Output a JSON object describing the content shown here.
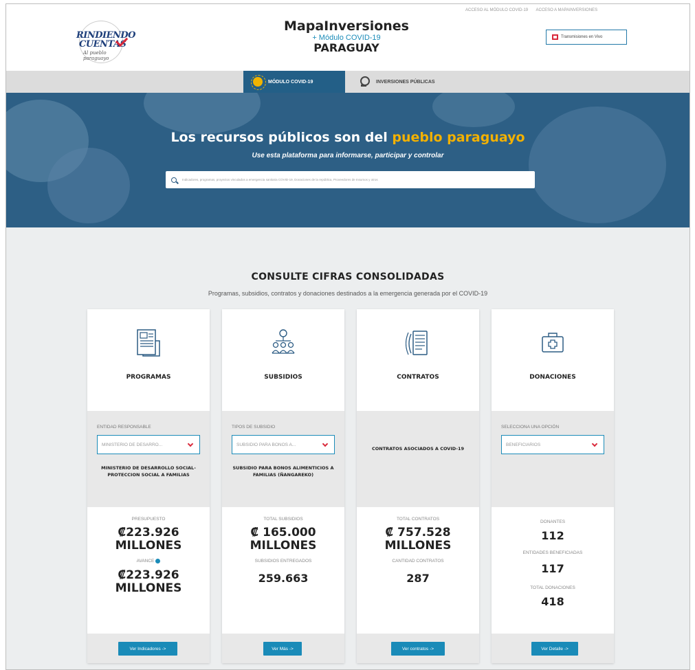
{
  "header": {
    "logo": {
      "line1": "RINDIENDO",
      "line2": "CUENTAS",
      "tagline": "Al pueblo paraguayo"
    },
    "brand": {
      "title": "MapaInversiones",
      "subtitle": "+ Módulo COVID-19",
      "country": "PARAGUAY"
    },
    "top_links": [
      "ACCESO AL MÓDULO COVID-19",
      "ACCESO A MAPAINVERSIONES"
    ],
    "live_button": "Transmisiones en Vivo"
  },
  "nav": {
    "tabs": [
      {
        "label": "MÓDULO COVID-19",
        "active": true,
        "icon": "virus-icon"
      },
      {
        "label": "INVERSIONES PÚBLICAS",
        "active": false,
        "icon": "coin-icon"
      }
    ]
  },
  "hero": {
    "title_part1": "Los recursos públicos son del",
    "title_highlight": "pueblo paraguayo",
    "subtitle": "Use esta plataforma para informarse, participar y controlar",
    "search_placeholder": "Indicadores, programas, proyectos vinculados a emergencia sanitaria COVID-19, Donaciones de la república, Proveedores de Insumos y otros"
  },
  "section": {
    "title": "CONSULTE CIFRAS CONSOLIDADAS",
    "subtitle": "Programas, subsidios, contratos y donaciones destinados a la emergencia generada por el COVID-19"
  },
  "cards": {
    "programas": {
      "name": "PROGRAMAS",
      "filter_label": "ENTIDAD RESPONSABLE",
      "filter_value": "MINISTERIO DE DESARRO...",
      "description": "MINISTERIO DE DESARROLLO SOCIAL-PROTECCION SOCIAL A FAMILIAS",
      "stat1_label": "PRESUPUESTO",
      "stat1_value_a": "₡223.926",
      "stat1_value_b": "MILLONES",
      "stat2_label": "AVANCE",
      "stat2_value_a": "₡223.926",
      "stat2_value_b": "MILLONES",
      "button": "Ver Indicadores ->"
    },
    "subsidios": {
      "name": "SUBSIDIOS",
      "filter_label": "TIPOS DE SUBSIDIO",
      "filter_value": "SUBSIDIO PARA BONOS A...",
      "description": "SUBSIDIO PARA BONOS ALIMENTICIOS A FAMILIAS (ÑANGAREKO)",
      "stat1_label": "TOTAL SUBSIDIOS",
      "stat1_value_a": "₡ 165.000",
      "stat1_value_b": "MILLONES",
      "stat2_label": "SUBSIDIOS ENTREGADOS",
      "stat2_value": "259.663",
      "button": "Ver Más ->"
    },
    "contratos": {
      "name": "CONTRATOS",
      "description": "CONTRATOS ASOCIADOS A COVID-19",
      "stat1_label": "TOTAL CONTRATOS",
      "stat1_value_a": "₡ 757.528",
      "stat1_value_b": "MILLONES",
      "stat2_label": "CANTIDAD CONTRATOS",
      "stat2_value": "287",
      "button": "Ver contratos ->"
    },
    "donaciones": {
      "name": "DONACIONES",
      "filter_label": "SELECCIONA UNA OPCIÓN",
      "filter_value": "BENEFICIARIOS",
      "stat1_label": "DONANTES",
      "stat1_value": "112",
      "stat2_label": "ENTIDADES BENEFICIADAS",
      "stat2_value": "117",
      "stat3_label": "TOTAL DONACIONES",
      "stat3_value": "418",
      "button": "Ver Detalle ->"
    }
  },
  "colors": {
    "accent": "#1a8bb8",
    "hero_bg": "#2d5f85",
    "highlight": "#f3b100",
    "alert": "#d9283a"
  }
}
